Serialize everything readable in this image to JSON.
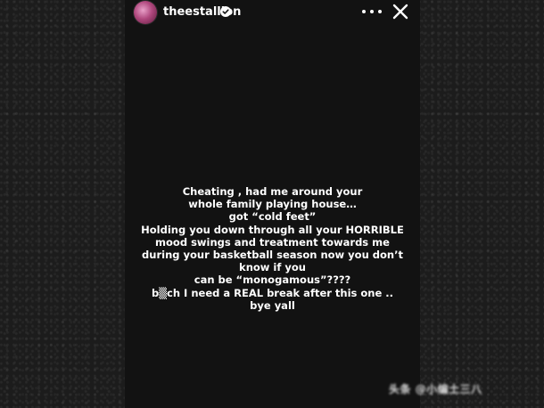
{
  "story": {
    "username": "theestallion",
    "text": "Cheating , had me around your\nwhole family playing house…\ngot “cold feet”\nHolding you down through all your HORRIBLE\nmood swings and treatment towards me\nduring your basketball season now you don’t\nknow if you\ncan be “monogamous”????\nb▒ch I need a REAL break after this one ..\nbye yall"
  },
  "watermark": {
    "text": "头条 @小编土三八"
  },
  "icons": {
    "verified": "verified-badge-icon",
    "more": "more-options-icon",
    "close": "close-icon"
  },
  "colors": {
    "story_bg": "#121212",
    "outer_bg": "#1c1c1c",
    "text": "#ffffff"
  }
}
